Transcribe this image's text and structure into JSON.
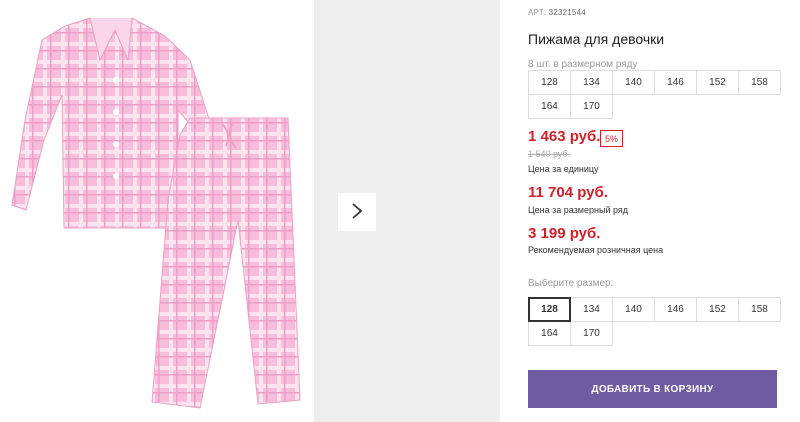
{
  "product": {
    "sku_prefix": "АРТ:",
    "sku_value": "32321544",
    "title": "Пижама для девочки",
    "qty_note": "8 шт. в размерном ряду"
  },
  "size_row": {
    "sizes": [
      "128",
      "134",
      "140",
      "146",
      "152",
      "158",
      "164",
      "170"
    ]
  },
  "pricing": {
    "unit_price": "1 463 руб.",
    "discount": "5%",
    "old_price": "1 540 руб.",
    "unit_label": "Цена за единицу",
    "row_price": "11 704 руб.",
    "row_label": "Цена за размерный ряд",
    "rrp_price": "3 199 руб.",
    "rrp_label": "Рекомендуемая розничная цена"
  },
  "size_select": {
    "label": "Выберите размер:",
    "sizes": [
      "128",
      "134",
      "140",
      "146",
      "152",
      "158",
      "164",
      "170"
    ],
    "selected": "128"
  },
  "actions": {
    "add_to_cart": "ДОБАВИТЬ В КОРЗИНУ"
  },
  "icons": {
    "next": "chevron-right-icon"
  },
  "colors": {
    "price_red": "#d0202a",
    "button_purple": "#6e5ba1",
    "panel_gray": "#eeeeee",
    "pajama_pink": "#f6b8d8"
  }
}
